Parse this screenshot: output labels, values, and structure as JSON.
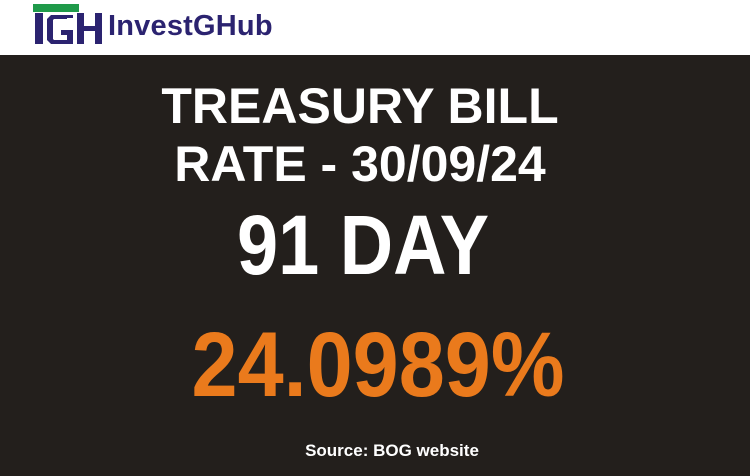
{
  "header": {
    "brand_name": "InvestGHub",
    "logo_icon": "igh-logo-icon",
    "colors": {
      "navy": "#2b2370",
      "green": "#1f9a4a"
    }
  },
  "panel": {
    "title_line_1": "TREASURY BILL",
    "title_line_2": "RATE - 30/09/24",
    "tenor": "91 DAY",
    "rate": "24.0989%",
    "source": "Source: BOG website",
    "colors": {
      "background": "#231f1c",
      "text": "#ffffff",
      "rate": "#ea7a1c"
    }
  }
}
